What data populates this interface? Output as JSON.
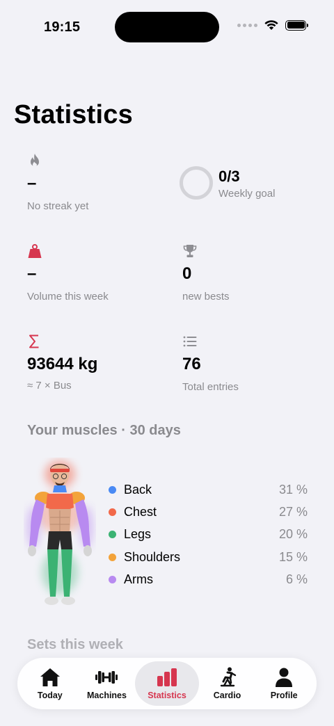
{
  "status_bar": {
    "time": "19:15"
  },
  "page": {
    "title": "Statistics"
  },
  "stats": {
    "streak": {
      "value": "–",
      "label": "No streak yet",
      "icon": "flame-icon"
    },
    "weekly_goal": {
      "value": "0/3",
      "label": "Weekly goal",
      "progress": 0
    },
    "volume": {
      "value": "–",
      "label": "Volume this week",
      "icon": "weight-icon"
    },
    "bests": {
      "value": "0",
      "label": "new bests",
      "icon": "trophy-icon"
    },
    "total_weight": {
      "value": "93644 kg",
      "label": "≈ 7 × Bus",
      "icon": "sigma-icon"
    },
    "entries": {
      "value": "76",
      "label": "Total entries",
      "icon": "list-icon"
    }
  },
  "muscles": {
    "title": "Your muscles · 30 days",
    "items": [
      {
        "name": "Back",
        "percent": "31 %",
        "color": "#4a8af4"
      },
      {
        "name": "Chest",
        "percent": "27 %",
        "color": "#f2694a"
      },
      {
        "name": "Legs",
        "percent": "20 %",
        "color": "#3bb273"
      },
      {
        "name": "Shoulders",
        "percent": "15 %",
        "color": "#f3a33a"
      },
      {
        "name": "Arms",
        "percent": "6 %",
        "color": "#b88af0"
      }
    ]
  },
  "sets_section": {
    "title": "Sets this week"
  },
  "tabs": [
    {
      "label": "Today",
      "icon": "house-icon"
    },
    {
      "label": "Machines",
      "icon": "dumbbell-icon"
    },
    {
      "label": "Statistics",
      "icon": "chart-bar-icon",
      "active": true
    },
    {
      "label": "Cardio",
      "icon": "bike-icon"
    },
    {
      "label": "Profile",
      "icon": "person-icon"
    }
  ],
  "colors": {
    "accent": "#d6364f",
    "background": "#f2f2f7",
    "muted": "#8a8a8e"
  }
}
